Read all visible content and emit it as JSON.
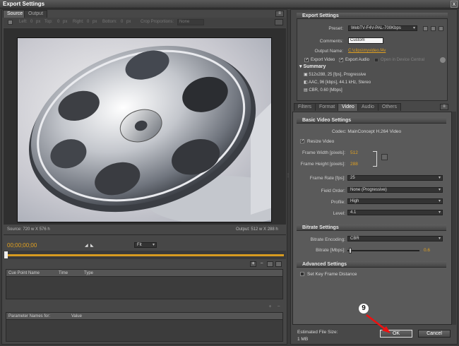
{
  "window": {
    "title": "Export Settings",
    "close": "x"
  },
  "left": {
    "tabs": [
      "Source",
      "Output"
    ],
    "toolbar": [
      "Left:",
      "0",
      "px",
      "Top:",
      "0",
      "px",
      "Right:",
      "0",
      "px",
      "Bottom:",
      "0",
      "px",
      "Crop Proportions:",
      "None"
    ],
    "source_size": "Source: 720 w X 576 h",
    "output_size": "Output: 512 w X 288 h",
    "timecode": "00;00;00;00",
    "fit": "Fit",
    "cue_cols": [
      "Cue Point Name",
      "Time",
      "Type"
    ],
    "param_cols": [
      "Parameter Names for:",
      "Value"
    ]
  },
  "export_settings": {
    "header": "Export Settings",
    "preset_label": "Preset:",
    "preset_value": "WebTV-F4V-PAL-700Kbps",
    "comments_label": "Comments:",
    "comments_value": "Custom",
    "output_name_label": "Output Name:",
    "output_name_value": "C:\\clips\\myvideo.f4v",
    "export_video": "Export Video",
    "export_audio": "Export Audio",
    "open_device_central": "Open in Device Central",
    "summary_header": "Summary",
    "summary": [
      "512x288, 25 [fps], Progressive",
      "AAC, 96 [kbps], 44.1 kHz, Stereo",
      "CBR, 0.60 [Mbps]"
    ]
  },
  "tabs": [
    "Filters",
    "Format",
    "Video",
    "Audio",
    "Others"
  ],
  "video": {
    "basic_header": "Basic Video Settings",
    "codec": "Codec: MainConcept H.264 Video",
    "resize": "Resize Video",
    "frame_width_label": "Frame Width [pixels]:",
    "frame_width": "512",
    "frame_height_label": "Frame Height [pixels]:",
    "frame_height": "288",
    "frame_rate_label": "Frame Rate [fps]:",
    "frame_rate": "25",
    "field_order_label": "Field Order:",
    "field_order": "None (Progressive)",
    "profile_label": "Profile:",
    "profile": "High",
    "level_label": "Level:",
    "level": "4.1",
    "bitrate_header": "Bitrate Settings",
    "bitrate_encoding_label": "Bitrate Encoding:",
    "bitrate_encoding": "CBR",
    "bitrate_label": "Bitrate [Mbps]:",
    "bitrate": "0.6",
    "bitrate_fraction": 0.02,
    "advanced_header": "Advanced Settings",
    "keyframe": "Set Key Frame Distance"
  },
  "footer": {
    "est_label": "Estimated File Size:",
    "est_value": "1 MB",
    "ok": "OK",
    "cancel": "Cancel",
    "callout": "9"
  }
}
